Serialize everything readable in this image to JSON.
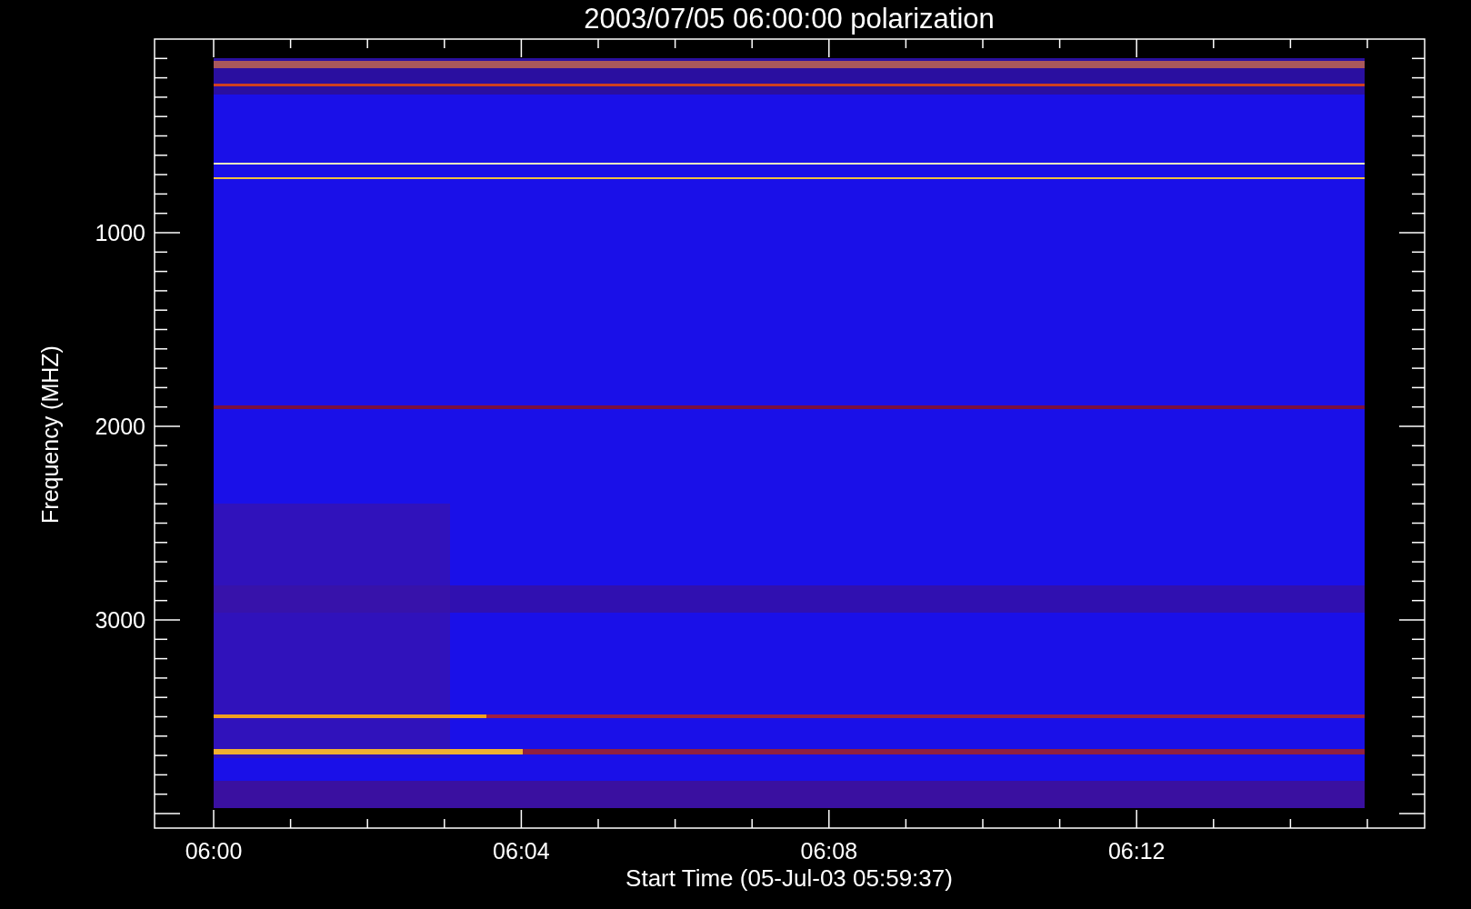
{
  "title": "2003/07/05 06:00:00 polarization",
  "x_axis": {
    "label": "Start Time (05-Jul-03 05:59:37)",
    "ticks": [
      "06:00",
      "06:04",
      "06:08",
      "06:12"
    ]
  },
  "y_axis": {
    "label": "Frequency (MHZ)",
    "ticks": [
      "1000",
      "2000",
      "3000"
    ]
  }
}
